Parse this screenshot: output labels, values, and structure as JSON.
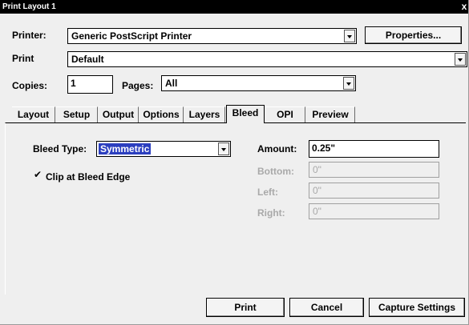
{
  "window": {
    "title": "Print Layout 1",
    "close_glyph": "x"
  },
  "printer": {
    "label": "Printer:",
    "value": "Generic PostScript Printer",
    "properties_label": "Properties..."
  },
  "print": {
    "label": "Print",
    "value": "Default"
  },
  "copies": {
    "label": "Copies:",
    "value": "1"
  },
  "pages": {
    "label": "Pages:",
    "value": "All"
  },
  "tabs": [
    {
      "label": "Layout"
    },
    {
      "label": "Setup"
    },
    {
      "label": "Output"
    },
    {
      "label": "Options"
    },
    {
      "label": "Layers"
    },
    {
      "label": "Bleed",
      "active": true
    },
    {
      "label": "OPI"
    },
    {
      "label": "Preview"
    }
  ],
  "bleed": {
    "type_label": "Bleed Type:",
    "type_value": "Symmetric",
    "clip_label": "Clip at Bleed Edge",
    "clip_checked": true,
    "amount_label": "Amount:",
    "amount_value": "0.25\"",
    "bottom_label": "Bottom:",
    "bottom_value": "0\"",
    "left_label": "Left:",
    "left_value": "0\"",
    "right_label": "Right:",
    "right_value": "0\""
  },
  "buttons": {
    "print": "Print",
    "cancel": "Cancel",
    "capture": "Capture Settings"
  }
}
